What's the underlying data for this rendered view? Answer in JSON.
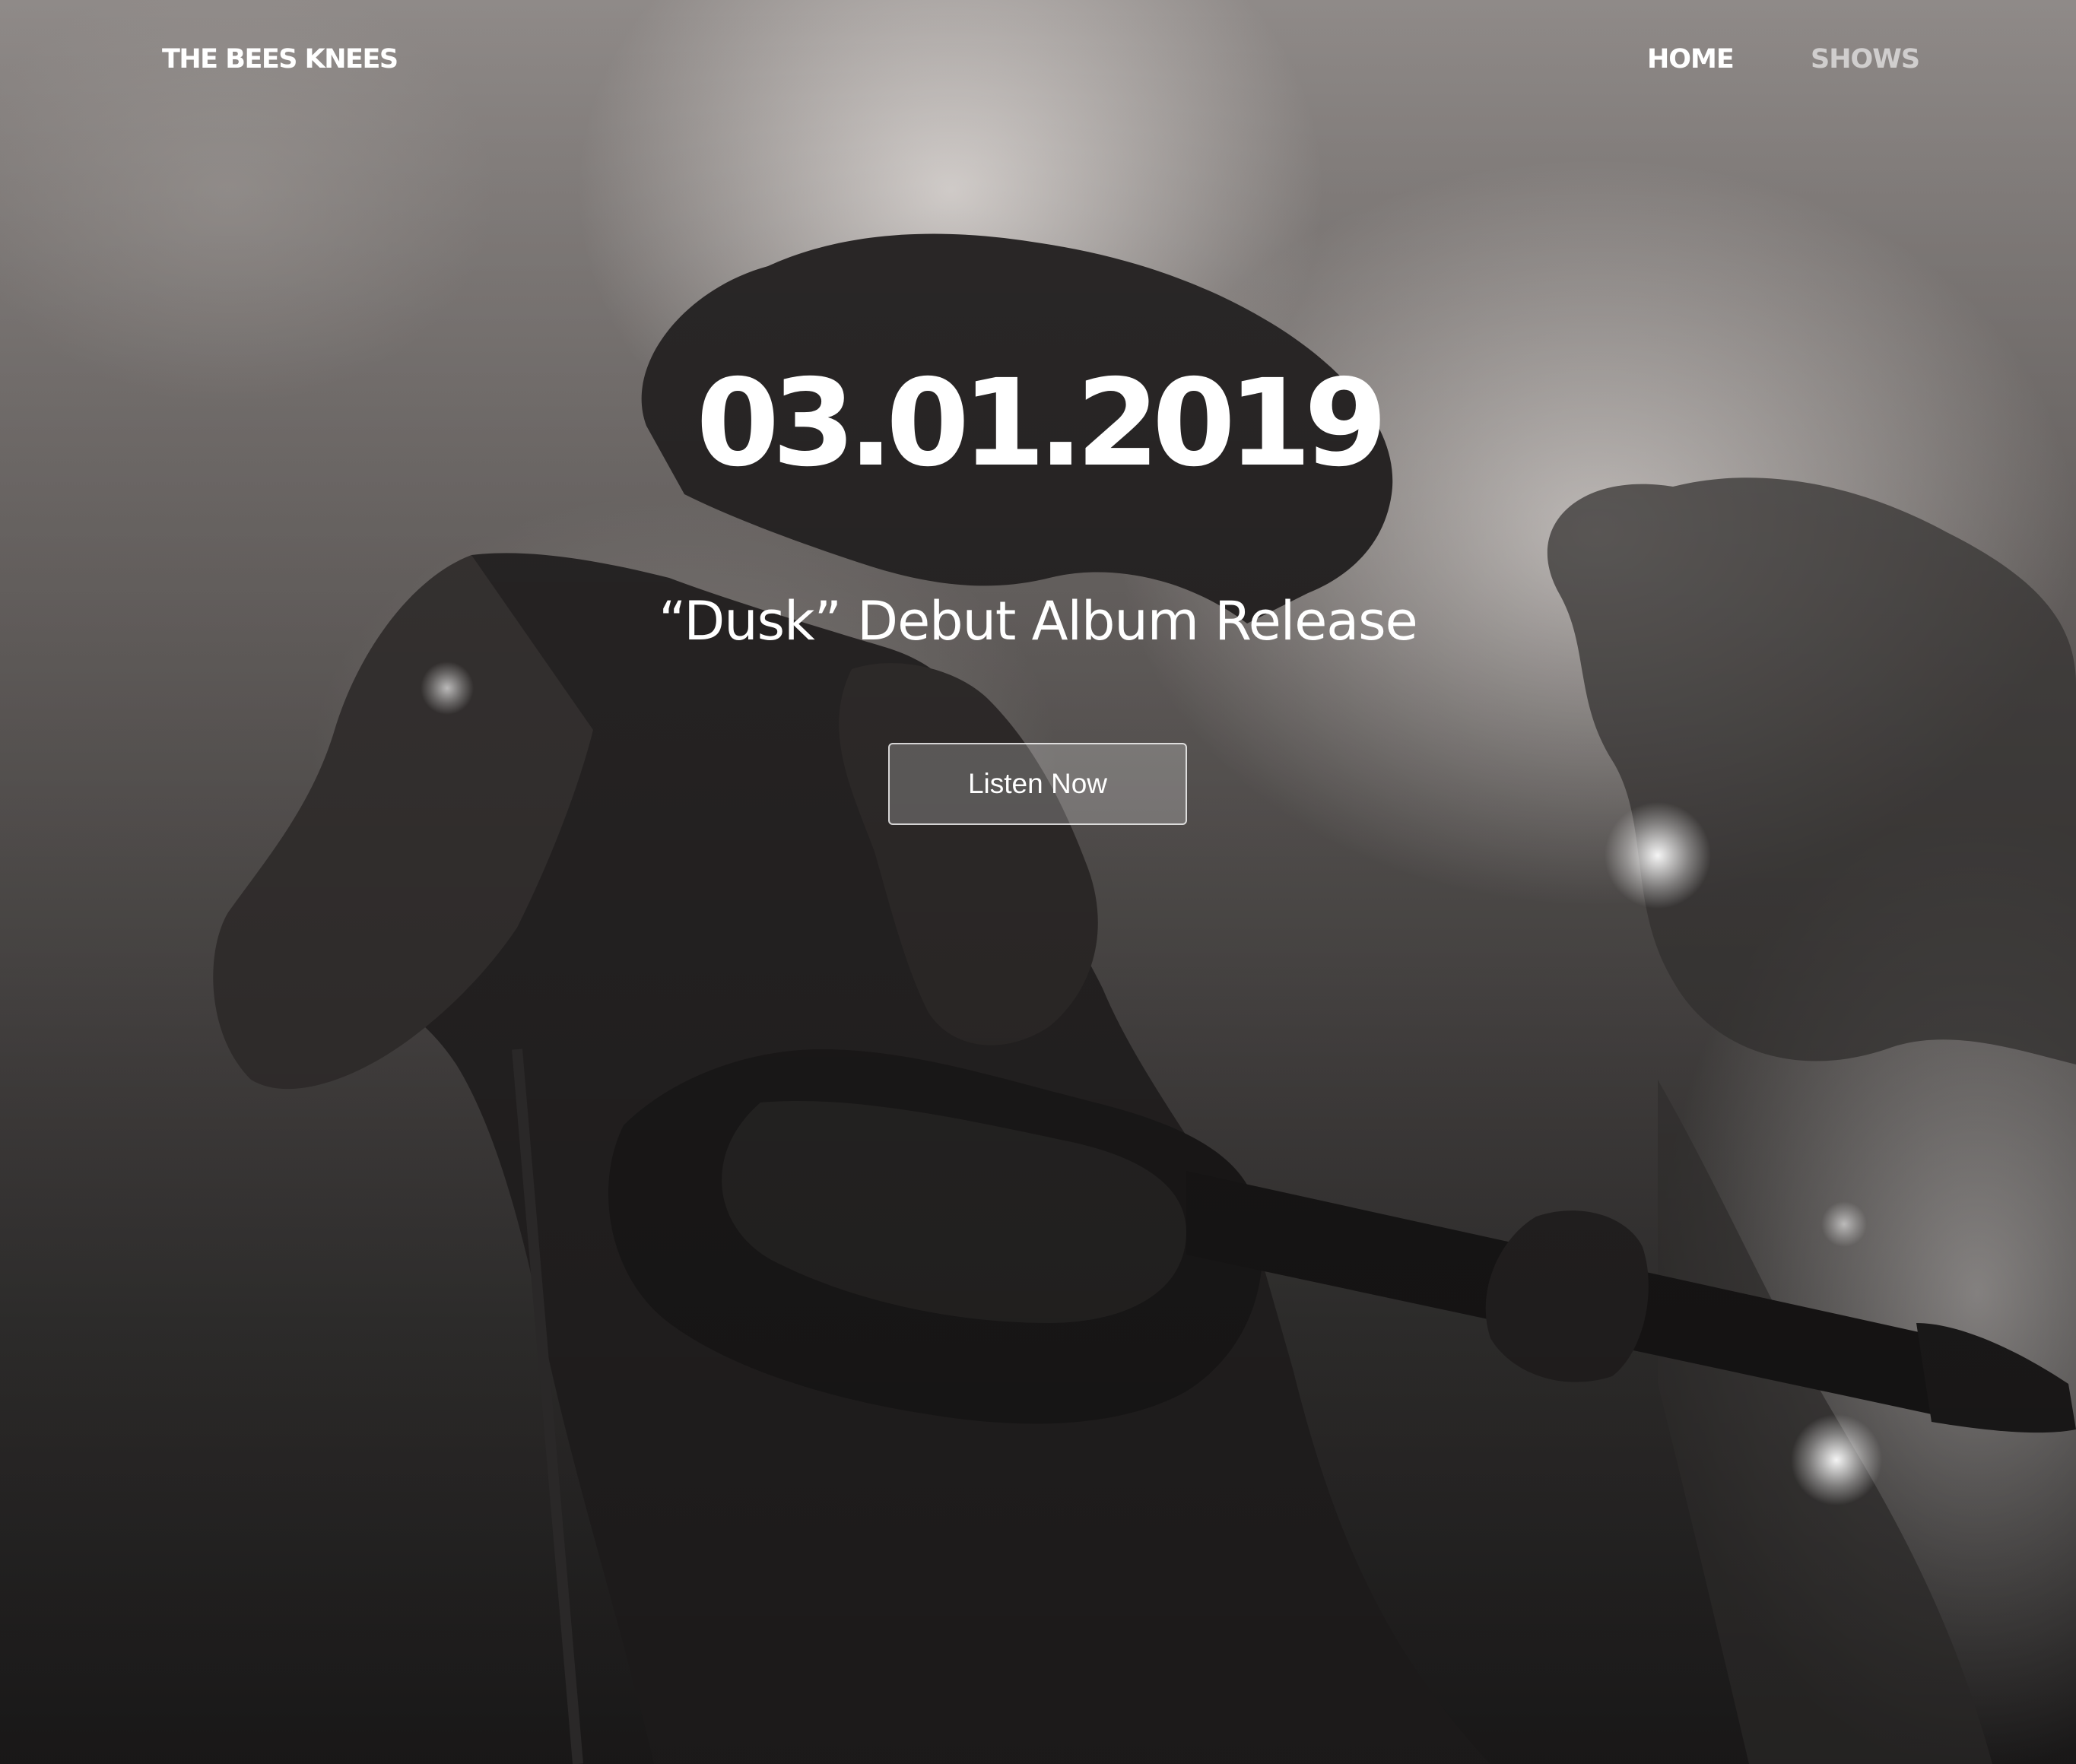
{
  "brand": {
    "name": "THE BEES KNEES"
  },
  "nav": {
    "items": [
      {
        "label": "HOME",
        "active": true
      },
      {
        "label": "SHOWS",
        "active": false
      }
    ]
  },
  "hero": {
    "date": "03.01.2019",
    "subtitle": "“Dusk” Debut Album Release",
    "cta_label": "Listen Now",
    "background_image": "monochrome photo of a curly-haired guitarist performing on a smoky stage with stage lights"
  },
  "colors": {
    "text": "#ffffff",
    "nav_inactive": "rgba(255,255,255,0.6)",
    "button_bg": "rgba(255,255,255,0.22)",
    "button_border": "rgba(255,255,255,0.75)"
  }
}
